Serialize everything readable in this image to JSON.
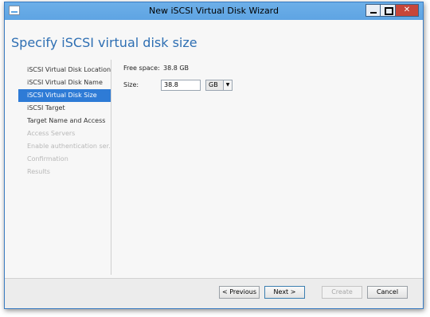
{
  "window": {
    "title": "New iSCSI Virtual Disk Wizard"
  },
  "title_buttons": {
    "minimize": "",
    "maximize": "",
    "close": "✕"
  },
  "page": {
    "heading": "Specify iSCSI virtual disk size"
  },
  "nav": {
    "items": [
      {
        "label": "iSCSI Virtual Disk Location",
        "state": "normal"
      },
      {
        "label": "iSCSI Virtual Disk Name",
        "state": "normal"
      },
      {
        "label": "iSCSI Virtual Disk Size",
        "state": "active"
      },
      {
        "label": "iSCSI Target",
        "state": "normal"
      },
      {
        "label": "Target Name and Access",
        "state": "normal"
      },
      {
        "label": "Access Servers",
        "state": "disabled"
      },
      {
        "label": "Enable authentication ser...",
        "state": "disabled"
      },
      {
        "label": "Confirmation",
        "state": "disabled"
      },
      {
        "label": "Results",
        "state": "disabled"
      }
    ]
  },
  "form": {
    "free_space_label": "Free space:",
    "free_space_value": "38.8 GB",
    "size_label": "Size:",
    "size_value": "38.8",
    "unit_value": "GB"
  },
  "footer": {
    "previous": "< Previous",
    "next": "Next >",
    "create": "Create",
    "cancel": "Cancel"
  },
  "colors": {
    "accent": "#2e7bd6",
    "title": "#2e6fb3",
    "titlebar": "#5ea4e3",
    "close": "#c7463a"
  }
}
